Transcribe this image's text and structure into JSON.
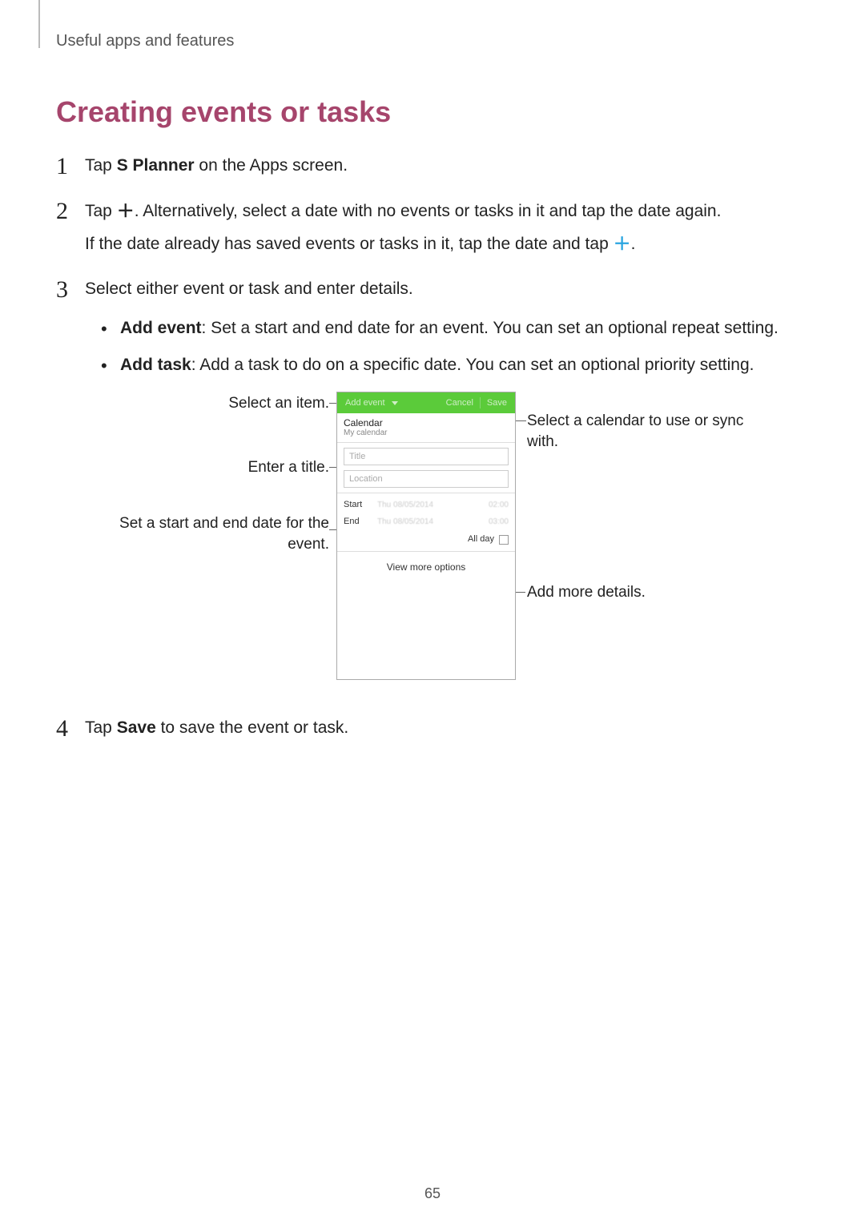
{
  "header": {
    "breadcrumb": "Useful apps and features"
  },
  "section": {
    "title": "Creating events or tasks"
  },
  "steps": {
    "s1": {
      "num": "1",
      "pre": "Tap ",
      "bold": "S Planner",
      "post": " on the Apps screen."
    },
    "s2": {
      "num": "2",
      "line1_pre": "Tap ",
      "line1_post": ". Alternatively, select a date with no events or tasks in it and tap the date again.",
      "line2_pre": "If the date already has saved events or tasks in it, tap the date and tap ",
      "line2_post": "."
    },
    "s3": {
      "num": "3",
      "text": "Select either event or task and enter details.",
      "bullet1_bold": "Add event",
      "bullet1_text": ": Set a start and end date for an event. You can set an optional repeat setting.",
      "bullet2_bold": "Add task",
      "bullet2_text": ": Add a task to do on a specific date. You can set an optional priority setting."
    },
    "s4": {
      "num": "4",
      "pre": "Tap ",
      "bold": "Save",
      "post": " to save the event or task."
    }
  },
  "callouts": {
    "select_item": "Select an item.",
    "enter_title": "Enter a title.",
    "dates": "Set a start and end date for the event.",
    "calendar": "Select a calendar to use or sync with.",
    "more": "Add more details."
  },
  "phone": {
    "tab": "Add event",
    "cancel": "Cancel",
    "save": "Save",
    "cal_title": "Calendar",
    "cal_sub": "My calendar",
    "title_placeholder": "Title",
    "location_placeholder": "Location",
    "start_label": "Start",
    "end_label": "End",
    "start_date": "Thu 08/05/2014",
    "start_time": "02:00",
    "end_date": "Thu 08/05/2014",
    "end_time": "03:00",
    "allday": "All day",
    "view_more": "View more options"
  },
  "page_number": "65"
}
